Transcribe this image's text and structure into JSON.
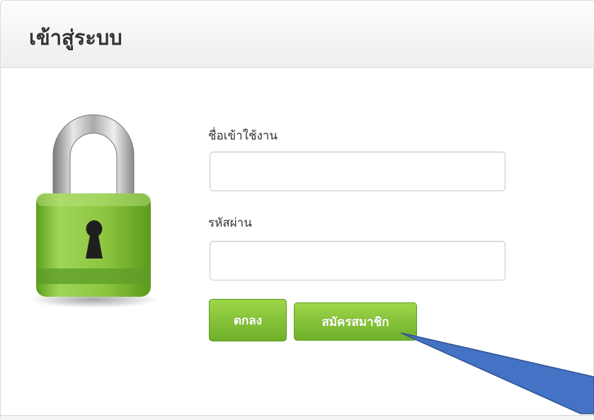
{
  "login": {
    "title": "เข้าสู่ระบบ",
    "username_label": "ชื่อเข้าใช้งาน",
    "username_value": "",
    "password_label": "รหัสผ่าน",
    "password_value": "",
    "ok_label": "ตกลง",
    "register_label": "สมัครสมาชิก"
  },
  "icons": {
    "lock": "padlock-icon",
    "annotation": "annotation-arrow"
  },
  "colors": {
    "button_green": "#7dbd34",
    "lock_green": "#8cc63f",
    "arrow_blue": "#4472c4"
  }
}
